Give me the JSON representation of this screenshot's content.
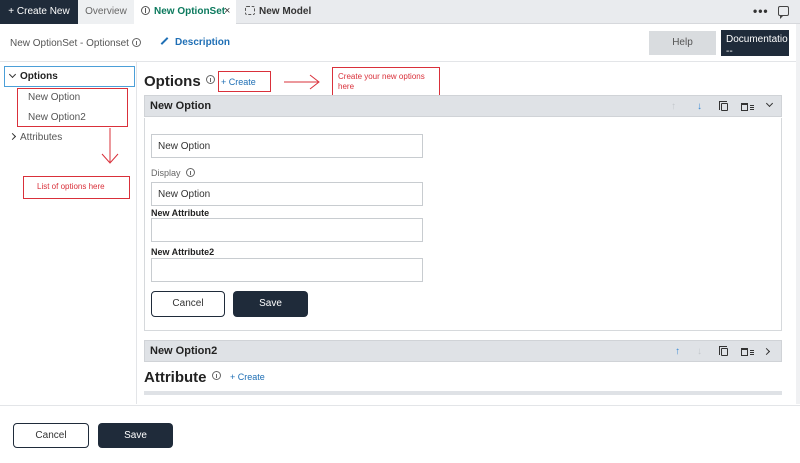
{
  "tabs": {
    "create_new": "+ Create New",
    "overview": "Overview",
    "option_set": "New OptionSet",
    "close": "×",
    "model": "New Model",
    "more": "•••"
  },
  "header": {
    "breadcrumb": "New OptionSet - Optionset",
    "description": "Description",
    "help": "Help",
    "documentation": "Documentatio\n--"
  },
  "sidebar": {
    "options": "Options",
    "items": [
      "New Option",
      "New Option2"
    ],
    "attributes": "Attributes"
  },
  "annotations": {
    "create_note": "Create your new options here",
    "list_note": "List of options here"
  },
  "main": {
    "options_title": "Options",
    "options_create": "+ Create",
    "option1": {
      "title": "New Option",
      "name_value": "New Option",
      "display_label": "Display",
      "display_value": "New Option",
      "attr1_label": "New Attribute",
      "attr1_value": "",
      "attr2_label": "New Attribute2",
      "attr2_value": "",
      "cancel": "Cancel",
      "save": "Save"
    },
    "option2": {
      "title": "New Option2"
    },
    "attribute_title": "Attribute",
    "attribute_create": "+ Create"
  },
  "footer": {
    "cancel": "Cancel",
    "save": "Save"
  },
  "colors": {
    "dark": "#1f2b3a",
    "accent": "#1f6fb5",
    "annotation": "#d9303a",
    "tab_active": "#0c7a5e"
  }
}
